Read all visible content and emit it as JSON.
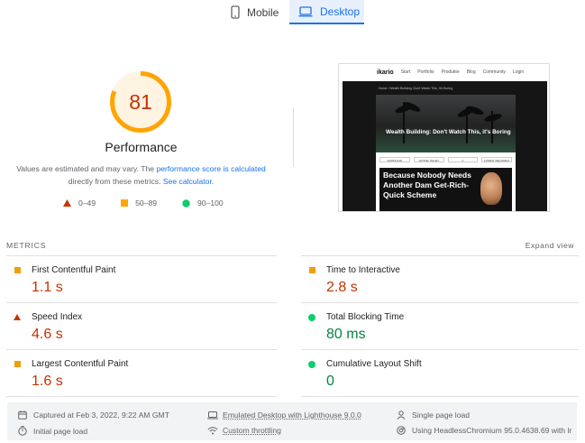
{
  "tabs": [
    {
      "label": "Mobile",
      "icon": "phone-icon",
      "selected": false
    },
    {
      "label": "Desktop",
      "icon": "laptop-icon",
      "selected": true
    }
  ],
  "score": {
    "value": "81",
    "fraction": 0.81,
    "title": "Performance",
    "desc_1": "Values are estimated and may vary. The",
    "desc_link_1": "performance score is calculated",
    "desc_2": "directly from these metrics.",
    "desc_link_2": "See calculator."
  },
  "legend": [
    {
      "range": "0–49",
      "shape": "triangle",
      "color": "#ff4e42"
    },
    {
      "range": "50–89",
      "shape": "square",
      "color": "#ffa400"
    },
    {
      "range": "90–100",
      "shape": "circle",
      "color": "#0cce6b"
    }
  ],
  "thumbnail": {
    "logo": "ikario",
    "nav": [
      "Start",
      "Portfolio",
      "Produkte",
      "Blog",
      "Community",
      "Login"
    ],
    "crumb": "Home  /  Wealth Building: Don't Watch This, It's Boring",
    "hero_title": "Wealth Building: Don't Watch This, it's Boring",
    "buttons": [
      "DOWNLOAD",
      "ARTIKEL TEILEN",
      "",
      "FORMAT WECHSELN"
    ],
    "panel_text": "Because Nobody Needs Another Dam Get-Rich-Quick Scheme"
  },
  "metrics": {
    "header": "METRICS",
    "expand": "Expand view",
    "items": [
      {
        "name": "First Contentful Paint",
        "value": "1.1 s",
        "status": "average"
      },
      {
        "name": "Time to Interactive",
        "value": "2.8 s",
        "status": "average"
      },
      {
        "name": "Speed Index",
        "value": "4.6 s",
        "status": "fail"
      },
      {
        "name": "Total Blocking Time",
        "value": "80 ms",
        "status": "pass"
      },
      {
        "name": "Largest Contentful Paint",
        "value": "1.6 s",
        "status": "average"
      },
      {
        "name": "Cumulative Layout Shift",
        "value": "0",
        "status": "pass"
      }
    ]
  },
  "footer": {
    "captured": "Captured at Feb 3, 2022, 9:22 AM GMT",
    "initial": "Initial page load",
    "emulated": "Emulated Desktop with Lighthouse 9.0.0",
    "throttling": "Custom throttling",
    "single": "Single page load",
    "browser": "Using HeadlessChromium 95.0.4638.69 with lr"
  },
  "colors": {
    "accent": "#1a73e8",
    "fail": "#c33300",
    "average_value": "#c33300",
    "pass_value": "#018642",
    "gauge_arc": "#ffa400",
    "gauge_track": "#fff2e0"
  }
}
